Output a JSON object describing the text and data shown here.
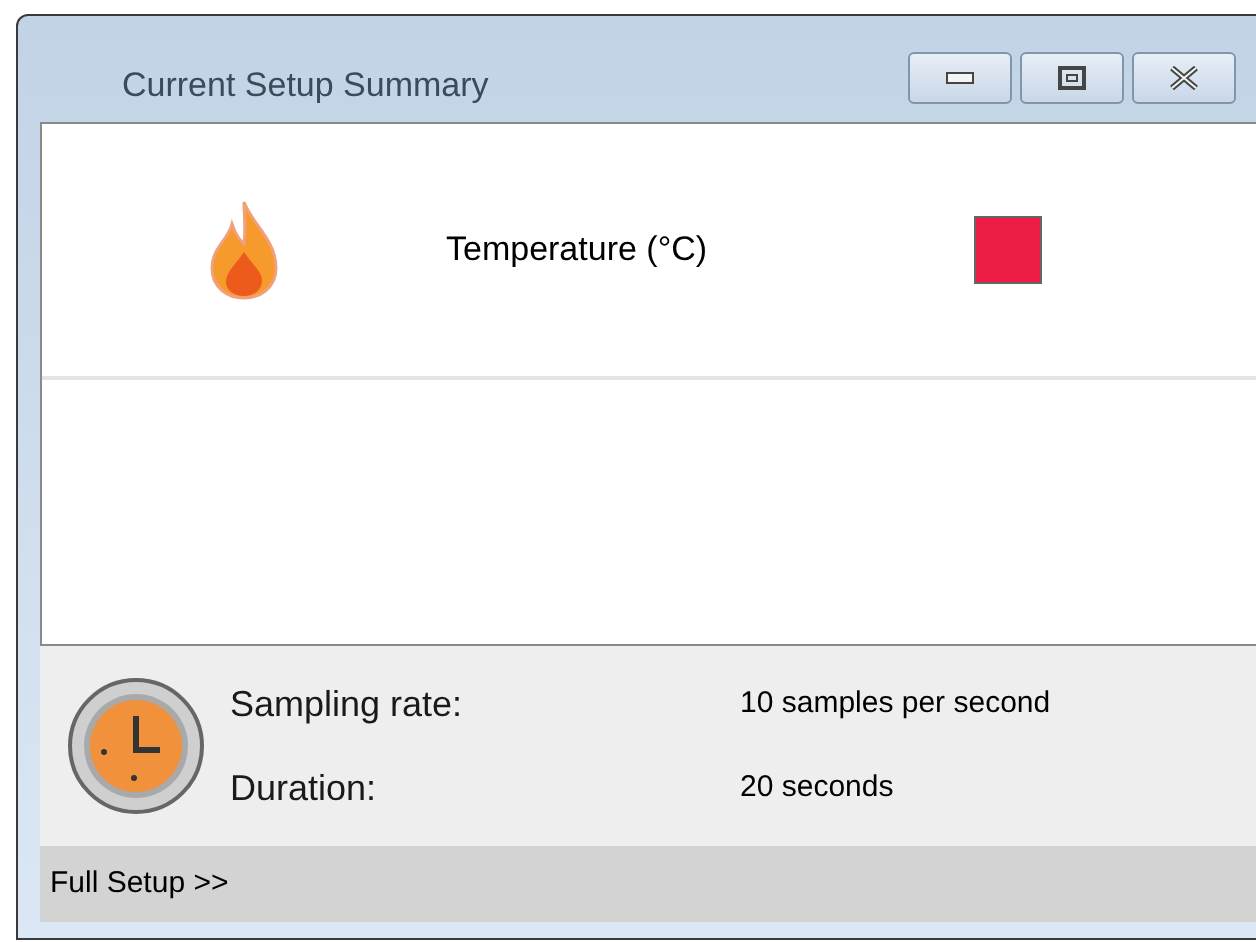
{
  "window": {
    "title": "Current Setup Summary"
  },
  "sensors": [
    {
      "name": "Temperature (°C)",
      "color": "#ec1c45"
    }
  ],
  "settings": [
    {
      "label": "Sampling rate:",
      "value": "10 samples per second"
    },
    {
      "label": "Duration:",
      "value": "20 seconds"
    }
  ],
  "footer": {
    "link": "Full Setup >>"
  }
}
